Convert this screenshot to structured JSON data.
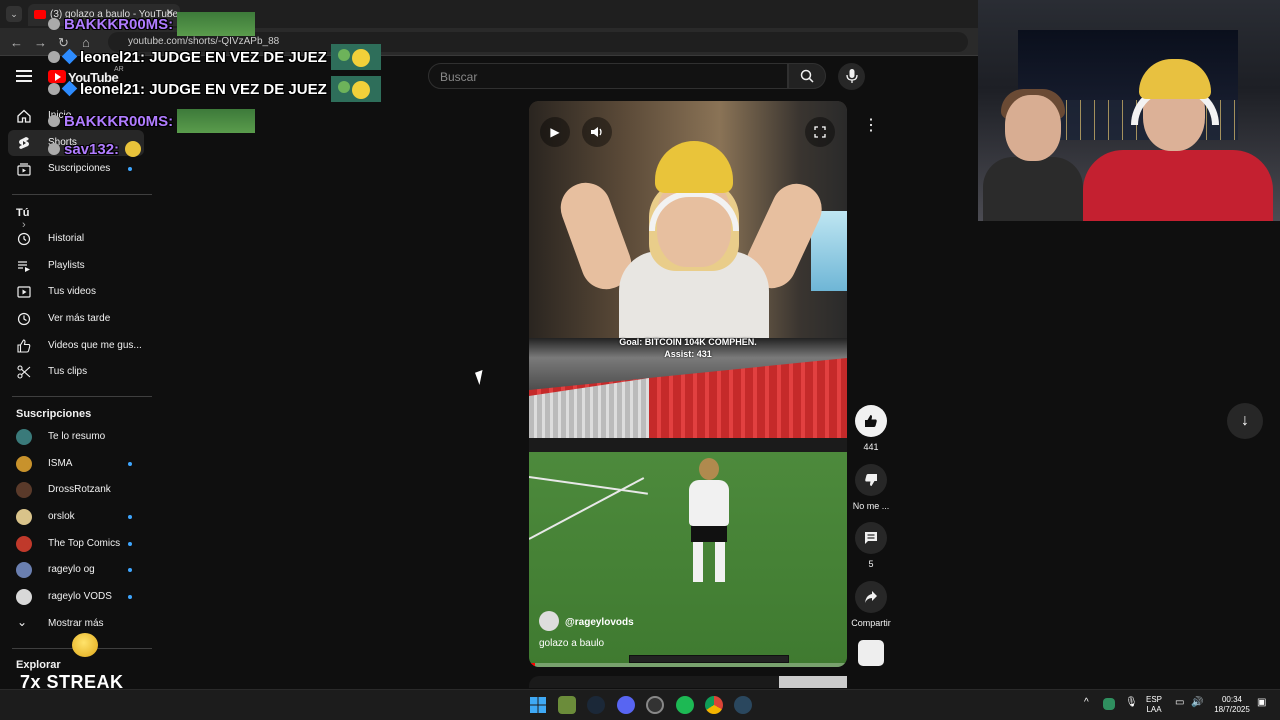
{
  "browser": {
    "tab_title": "(3) golazo a baulo - YouTube",
    "url": "youtube.com/shorts/-QIVzAPb_88"
  },
  "header": {
    "logo_text": "YouTube",
    "country": "AR",
    "search_placeholder": "Buscar"
  },
  "sidebar": {
    "top": [
      {
        "label": "Inicio",
        "icon": "home-icon"
      },
      {
        "label": "Shorts",
        "icon": "shorts-icon"
      },
      {
        "label": "Suscripciones",
        "icon": "subscriptions-icon",
        "dot": true
      }
    ],
    "you_heading": "Tú",
    "you_items": [
      {
        "label": "Historial",
        "icon": "history-icon"
      },
      {
        "label": "Playlists",
        "icon": "playlist-icon"
      },
      {
        "label": "Tus videos",
        "icon": "video-icon"
      },
      {
        "label": "Ver más tarde",
        "icon": "clock-icon"
      },
      {
        "label": "Videos que me gus...",
        "icon": "thumbs-up-icon"
      },
      {
        "label": "Tus clips",
        "icon": "scissors-icon"
      }
    ],
    "subs_heading": "Suscripciones",
    "subs": [
      {
        "label": "Te lo resumo",
        "color": "#3a7a7a",
        "dot": false
      },
      {
        "label": "ISMA",
        "color": "#c8922c",
        "dot": true
      },
      {
        "label": "DrossRotzank",
        "color": "#5a3a2a",
        "dot": false
      },
      {
        "label": "orslok",
        "color": "#d9c38a",
        "dot": true
      },
      {
        "label": "The Top Comics",
        "color": "#c0392b",
        "dot": true
      },
      {
        "label": "rageylo og",
        "color": "#6a7fb0",
        "dot": true
      },
      {
        "label": "rageylo VODS",
        "color": "#d8d8d8",
        "dot": true
      }
    ],
    "show_more": "Mostrar más",
    "explore_heading": "Explorar"
  },
  "chat": [
    {
      "user": "BAKKKR00MS:",
      "message": "",
      "emote": "pitch"
    },
    {
      "user": "leonel21:",
      "message": "JUDGE EN VEZ DE JUEZ",
      "emote": "pepe"
    },
    {
      "user": "leonel21:",
      "message": "JUDGE EN VEZ DE JUEZ",
      "emote": "pepe"
    },
    {
      "user": "BAKKKR00MS:",
      "message": "",
      "emote": "pitch"
    },
    {
      "user": "sav132:",
      "message": "",
      "emote": "smile"
    }
  ],
  "overlay": {
    "streak": "7x STREAK"
  },
  "short": {
    "goal_line1": "Goal: BITCOIN 104K COMPHEN.",
    "goal_line2": "Assist: 431",
    "channel": "@rageylovods",
    "caption": "golazo a baulo",
    "progress": 0.02
  },
  "actions": {
    "likes": "441",
    "dislike_label": "No me ...",
    "comments": "5",
    "share_label": "Compartir"
  },
  "taskbar": {
    "lang_line1": "ESP",
    "lang_line2": "LAA",
    "time": "00:34",
    "date": "18/7/2025"
  },
  "colors": {
    "accent_red": "#ff0000",
    "background": "#0f0f0f",
    "sub_dot": "#3ea6ff"
  }
}
